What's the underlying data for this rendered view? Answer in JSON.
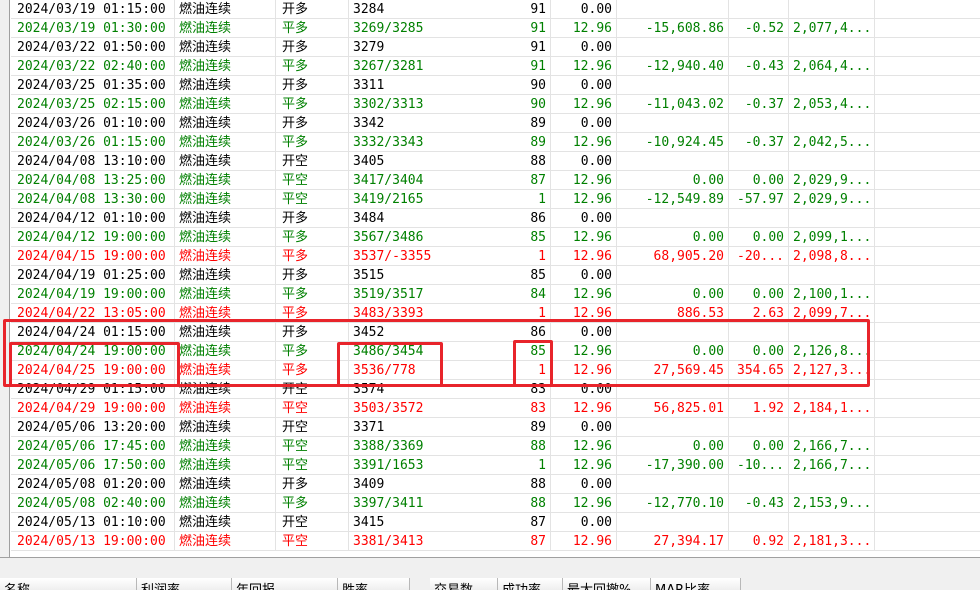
{
  "rows": [
    {
      "dt": "2024/03/19 01:15:00",
      "name": "燃油连续",
      "action": "开多",
      "price": "3284",
      "qty": "91",
      "fee": "0.00",
      "profit": "",
      "ratio": "",
      "equity": "",
      "color": "black"
    },
    {
      "dt": "2024/03/19 01:30:00",
      "name": "燃油连续",
      "action": "平多",
      "price": "3269/3285",
      "qty": "91",
      "fee": "12.96",
      "profit": "-15,608.86",
      "ratio": "-0.52",
      "equity": "2,077,4...",
      "color": "green"
    },
    {
      "dt": "2024/03/22 01:50:00",
      "name": "燃油连续",
      "action": "开多",
      "price": "3279",
      "qty": "91",
      "fee": "0.00",
      "profit": "",
      "ratio": "",
      "equity": "",
      "color": "black"
    },
    {
      "dt": "2024/03/22 02:40:00",
      "name": "燃油连续",
      "action": "平多",
      "price": "3267/3281",
      "qty": "91",
      "fee": "12.96",
      "profit": "-12,940.40",
      "ratio": "-0.43",
      "equity": "2,064,4...",
      "color": "green"
    },
    {
      "dt": "2024/03/25 01:35:00",
      "name": "燃油连续",
      "action": "开多",
      "price": "3311",
      "qty": "90",
      "fee": "0.00",
      "profit": "",
      "ratio": "",
      "equity": "",
      "color": "black"
    },
    {
      "dt": "2024/03/25 02:15:00",
      "name": "燃油连续",
      "action": "平多",
      "price": "3302/3313",
      "qty": "90",
      "fee": "12.96",
      "profit": "-11,043.02",
      "ratio": "-0.37",
      "equity": "2,053,4...",
      "color": "green"
    },
    {
      "dt": "2024/03/26 01:10:00",
      "name": "燃油连续",
      "action": "开多",
      "price": "3342",
      "qty": "89",
      "fee": "0.00",
      "profit": "",
      "ratio": "",
      "equity": "",
      "color": "black"
    },
    {
      "dt": "2024/03/26 01:15:00",
      "name": "燃油连续",
      "action": "平多",
      "price": "3332/3343",
      "qty": "89",
      "fee": "12.96",
      "profit": "-10,924.45",
      "ratio": "-0.37",
      "equity": "2,042,5...",
      "color": "green"
    },
    {
      "dt": "2024/04/08 13:10:00",
      "name": "燃油连续",
      "action": "开空",
      "price": "3405",
      "qty": "88",
      "fee": "0.00",
      "profit": "",
      "ratio": "",
      "equity": "",
      "color": "black"
    },
    {
      "dt": "2024/04/08 13:25:00",
      "name": "燃油连续",
      "action": "平空",
      "price": "3417/3404",
      "qty": "87",
      "fee": "12.96",
      "profit": "0.00",
      "ratio": "0.00",
      "equity": "2,029,9...",
      "color": "green"
    },
    {
      "dt": "2024/04/08 13:30:00",
      "name": "燃油连续",
      "action": "平空",
      "price": "3419/2165",
      "qty": "1",
      "fee": "12.96",
      "profit": "-12,549.89",
      "ratio": "-57.97",
      "equity": "2,029,9...",
      "color": "green"
    },
    {
      "dt": "2024/04/12 01:10:00",
      "name": "燃油连续",
      "action": "开多",
      "price": "3484",
      "qty": "86",
      "fee": "0.00",
      "profit": "",
      "ratio": "",
      "equity": "",
      "color": "black"
    },
    {
      "dt": "2024/04/12 19:00:00",
      "name": "燃油连续",
      "action": "平多",
      "price": "3567/3486",
      "qty": "85",
      "fee": "12.96",
      "profit": "0.00",
      "ratio": "0.00",
      "equity": "2,099,1...",
      "color": "green"
    },
    {
      "dt": "2024/04/15 19:00:00",
      "name": "燃油连续",
      "action": "平多",
      "price": "3537/-3355",
      "qty": "1",
      "fee": "12.96",
      "profit": "68,905.20",
      "ratio": "-20...",
      "equity": "2,098,8...",
      "color": "red"
    },
    {
      "dt": "2024/04/19 01:25:00",
      "name": "燃油连续",
      "action": "开多",
      "price": "3515",
      "qty": "85",
      "fee": "0.00",
      "profit": "",
      "ratio": "",
      "equity": "",
      "color": "black"
    },
    {
      "dt": "2024/04/19 19:00:00",
      "name": "燃油连续",
      "action": "平多",
      "price": "3519/3517",
      "qty": "84",
      "fee": "12.96",
      "profit": "0.00",
      "ratio": "0.00",
      "equity": "2,100,1...",
      "color": "green"
    },
    {
      "dt": "2024/04/22 13:05:00",
      "name": "燃油连续",
      "action": "平多",
      "price": "3483/3393",
      "qty": "1",
      "fee": "12.96",
      "profit": "886.53",
      "ratio": "2.63",
      "equity": "2,099,7...",
      "color": "red"
    },
    {
      "dt": "2024/04/24 01:15:00",
      "name": "燃油连续",
      "action": "开多",
      "price": "3452",
      "qty": "86",
      "fee": "0.00",
      "profit": "",
      "ratio": "",
      "equity": "",
      "color": "black"
    },
    {
      "dt": "2024/04/24 19:00:00",
      "name": "燃油连续",
      "action": "平多",
      "price": "3486/3454",
      "qty": "85",
      "fee": "12.96",
      "profit": "0.00",
      "ratio": "0.00",
      "equity": "2,126,8...",
      "color": "green"
    },
    {
      "dt": "2024/04/25 19:00:00",
      "name": "燃油连续",
      "action": "平多",
      "price": "3536/778",
      "qty": "1",
      "fee": "12.96",
      "profit": "27,569.45",
      "ratio": "354.65",
      "equity": "2,127,3...",
      "color": "red"
    },
    {
      "dt": "2024/04/29 01:15:00",
      "name": "燃油连续",
      "action": "开空",
      "price": "3574",
      "qty": "83",
      "fee": "0.00",
      "profit": "",
      "ratio": "",
      "equity": "",
      "color": "black"
    },
    {
      "dt": "2024/04/29 19:00:00",
      "name": "燃油连续",
      "action": "平空",
      "price": "3503/3572",
      "qty": "83",
      "fee": "12.96",
      "profit": "56,825.01",
      "ratio": "1.92",
      "equity": "2,184,1...",
      "color": "red"
    },
    {
      "dt": "2024/05/06 13:20:00",
      "name": "燃油连续",
      "action": "开空",
      "price": "3371",
      "qty": "89",
      "fee": "0.00",
      "profit": "",
      "ratio": "",
      "equity": "",
      "color": "black"
    },
    {
      "dt": "2024/05/06 17:45:00",
      "name": "燃油连续",
      "action": "平空",
      "price": "3388/3369",
      "qty": "88",
      "fee": "12.96",
      "profit": "0.00",
      "ratio": "0.00",
      "equity": "2,166,7...",
      "color": "green"
    },
    {
      "dt": "2024/05/06 17:50:00",
      "name": "燃油连续",
      "action": "平空",
      "price": "3391/1653",
      "qty": "1",
      "fee": "12.96",
      "profit": "-17,390.00",
      "ratio": "-10...",
      "equity": "2,166,7...",
      "color": "green"
    },
    {
      "dt": "2024/05/08 01:20:00",
      "name": "燃油连续",
      "action": "开多",
      "price": "3409",
      "qty": "88",
      "fee": "0.00",
      "profit": "",
      "ratio": "",
      "equity": "",
      "color": "black"
    },
    {
      "dt": "2024/05/08 02:40:00",
      "name": "燃油连续",
      "action": "平多",
      "price": "3397/3411",
      "qty": "88",
      "fee": "12.96",
      "profit": "-12,770.10",
      "ratio": "-0.43",
      "equity": "2,153,9...",
      "color": "green"
    },
    {
      "dt": "2024/05/13 01:10:00",
      "name": "燃油连续",
      "action": "开空",
      "price": "3415",
      "qty": "87",
      "fee": "0.00",
      "profit": "",
      "ratio": "",
      "equity": "",
      "color": "black"
    },
    {
      "dt": "2024/05/13 19:00:00",
      "name": "燃油连续",
      "action": "平空",
      "price": "3381/3413",
      "qty": "87",
      "fee": "12.96",
      "profit": "27,394.17",
      "ratio": "0.92",
      "equity": "2,181,3...",
      "color": "red"
    }
  ],
  "footer": {
    "headers": [
      "名称",
      "利润率",
      "年回报",
      "胜率",
      "交易数",
      "成功率",
      "最大回撤%",
      "MAR比率"
    ]
  },
  "colors": {
    "buy_open": "#000000",
    "close_loss": "#008000",
    "close_profit": "#ff0000",
    "highlight": "#e8242b"
  }
}
